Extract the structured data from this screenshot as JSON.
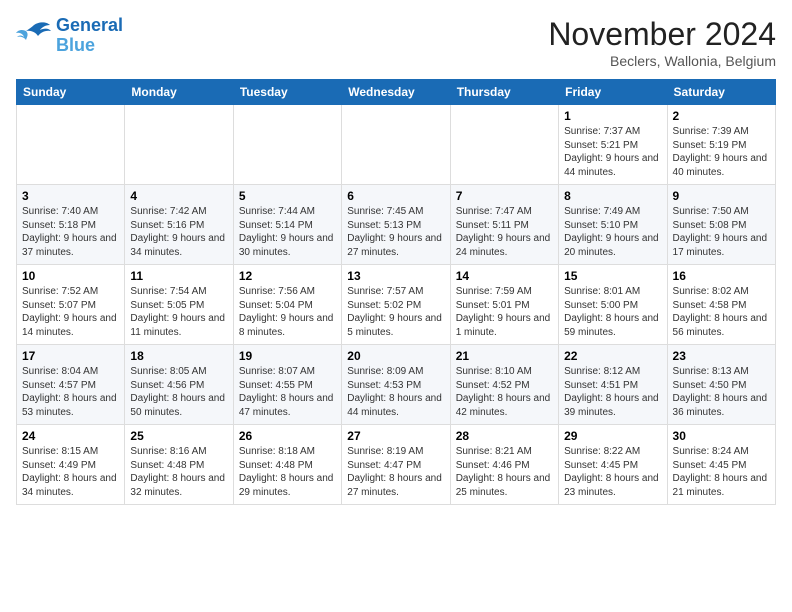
{
  "header": {
    "logo_line1": "General",
    "logo_line2": "Blue",
    "month": "November 2024",
    "location": "Beclers, Wallonia, Belgium"
  },
  "weekdays": [
    "Sunday",
    "Monday",
    "Tuesday",
    "Wednesday",
    "Thursday",
    "Friday",
    "Saturday"
  ],
  "weeks": [
    [
      {
        "day": "",
        "info": ""
      },
      {
        "day": "",
        "info": ""
      },
      {
        "day": "",
        "info": ""
      },
      {
        "day": "",
        "info": ""
      },
      {
        "day": "",
        "info": ""
      },
      {
        "day": "1",
        "info": "Sunrise: 7:37 AM\nSunset: 5:21 PM\nDaylight: 9 hours and 44 minutes."
      },
      {
        "day": "2",
        "info": "Sunrise: 7:39 AM\nSunset: 5:19 PM\nDaylight: 9 hours and 40 minutes."
      }
    ],
    [
      {
        "day": "3",
        "info": "Sunrise: 7:40 AM\nSunset: 5:18 PM\nDaylight: 9 hours and 37 minutes."
      },
      {
        "day": "4",
        "info": "Sunrise: 7:42 AM\nSunset: 5:16 PM\nDaylight: 9 hours and 34 minutes."
      },
      {
        "day": "5",
        "info": "Sunrise: 7:44 AM\nSunset: 5:14 PM\nDaylight: 9 hours and 30 minutes."
      },
      {
        "day": "6",
        "info": "Sunrise: 7:45 AM\nSunset: 5:13 PM\nDaylight: 9 hours and 27 minutes."
      },
      {
        "day": "7",
        "info": "Sunrise: 7:47 AM\nSunset: 5:11 PM\nDaylight: 9 hours and 24 minutes."
      },
      {
        "day": "8",
        "info": "Sunrise: 7:49 AM\nSunset: 5:10 PM\nDaylight: 9 hours and 20 minutes."
      },
      {
        "day": "9",
        "info": "Sunrise: 7:50 AM\nSunset: 5:08 PM\nDaylight: 9 hours and 17 minutes."
      }
    ],
    [
      {
        "day": "10",
        "info": "Sunrise: 7:52 AM\nSunset: 5:07 PM\nDaylight: 9 hours and 14 minutes."
      },
      {
        "day": "11",
        "info": "Sunrise: 7:54 AM\nSunset: 5:05 PM\nDaylight: 9 hours and 11 minutes."
      },
      {
        "day": "12",
        "info": "Sunrise: 7:56 AM\nSunset: 5:04 PM\nDaylight: 9 hours and 8 minutes."
      },
      {
        "day": "13",
        "info": "Sunrise: 7:57 AM\nSunset: 5:02 PM\nDaylight: 9 hours and 5 minutes."
      },
      {
        "day": "14",
        "info": "Sunrise: 7:59 AM\nSunset: 5:01 PM\nDaylight: 9 hours and 1 minute."
      },
      {
        "day": "15",
        "info": "Sunrise: 8:01 AM\nSunset: 5:00 PM\nDaylight: 8 hours and 59 minutes."
      },
      {
        "day": "16",
        "info": "Sunrise: 8:02 AM\nSunset: 4:58 PM\nDaylight: 8 hours and 56 minutes."
      }
    ],
    [
      {
        "day": "17",
        "info": "Sunrise: 8:04 AM\nSunset: 4:57 PM\nDaylight: 8 hours and 53 minutes."
      },
      {
        "day": "18",
        "info": "Sunrise: 8:05 AM\nSunset: 4:56 PM\nDaylight: 8 hours and 50 minutes."
      },
      {
        "day": "19",
        "info": "Sunrise: 8:07 AM\nSunset: 4:55 PM\nDaylight: 8 hours and 47 minutes."
      },
      {
        "day": "20",
        "info": "Sunrise: 8:09 AM\nSunset: 4:53 PM\nDaylight: 8 hours and 44 minutes."
      },
      {
        "day": "21",
        "info": "Sunrise: 8:10 AM\nSunset: 4:52 PM\nDaylight: 8 hours and 42 minutes."
      },
      {
        "day": "22",
        "info": "Sunrise: 8:12 AM\nSunset: 4:51 PM\nDaylight: 8 hours and 39 minutes."
      },
      {
        "day": "23",
        "info": "Sunrise: 8:13 AM\nSunset: 4:50 PM\nDaylight: 8 hours and 36 minutes."
      }
    ],
    [
      {
        "day": "24",
        "info": "Sunrise: 8:15 AM\nSunset: 4:49 PM\nDaylight: 8 hours and 34 minutes."
      },
      {
        "day": "25",
        "info": "Sunrise: 8:16 AM\nSunset: 4:48 PM\nDaylight: 8 hours and 32 minutes."
      },
      {
        "day": "26",
        "info": "Sunrise: 8:18 AM\nSunset: 4:48 PM\nDaylight: 8 hours and 29 minutes."
      },
      {
        "day": "27",
        "info": "Sunrise: 8:19 AM\nSunset: 4:47 PM\nDaylight: 8 hours and 27 minutes."
      },
      {
        "day": "28",
        "info": "Sunrise: 8:21 AM\nSunset: 4:46 PM\nDaylight: 8 hours and 25 minutes."
      },
      {
        "day": "29",
        "info": "Sunrise: 8:22 AM\nSunset: 4:45 PM\nDaylight: 8 hours and 23 minutes."
      },
      {
        "day": "30",
        "info": "Sunrise: 8:24 AM\nSunset: 4:45 PM\nDaylight: 8 hours and 21 minutes."
      }
    ]
  ]
}
